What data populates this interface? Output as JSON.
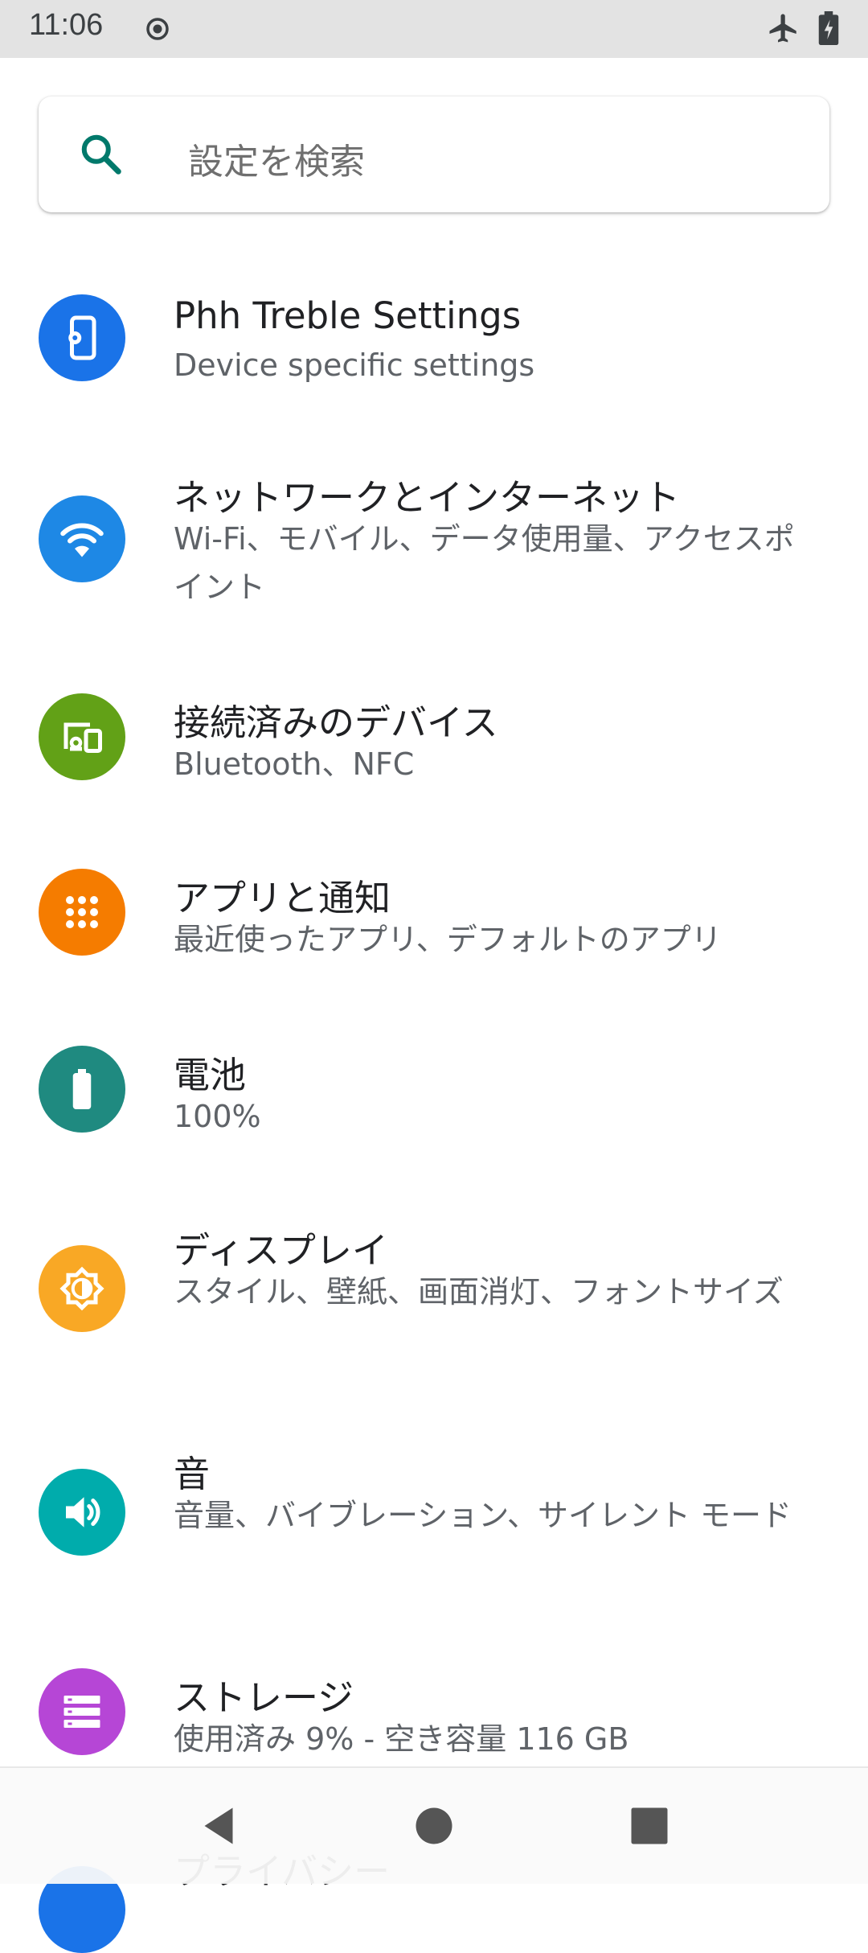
{
  "status_bar": {
    "time": "11:06"
  },
  "search": {
    "placeholder": "設定を検索"
  },
  "settings": [
    {
      "title": "Phh Treble Settings",
      "subtitle": "Device specific settings",
      "icon": "phone-gear-icon",
      "color": "#1a73e8"
    },
    {
      "title": "ネットワークとインターネット",
      "subtitle": "Wi-Fi、モバイル、データ使用量、アクセスポイント",
      "icon": "wifi-icon",
      "color": "#1e88e5"
    },
    {
      "title": "接続済みのデバイス",
      "subtitle": "Bluetooth、NFC",
      "icon": "devices-icon",
      "color": "#62a117"
    },
    {
      "title": "アプリと通知",
      "subtitle": "最近使ったアプリ、デフォルトのアプリ",
      "icon": "apps-grid-icon",
      "color": "#f57c00"
    },
    {
      "title": "電池",
      "subtitle": "100%",
      "icon": "battery-icon",
      "color": "#1f8a80"
    },
    {
      "title": "ディスプレイ",
      "subtitle": "スタイル、壁紙、画面消灯、フォントサイズ",
      "icon": "brightness-icon",
      "color": "#f9a825"
    },
    {
      "title": "音",
      "subtitle": "音量、バイブレーション、サイレント モード",
      "icon": "volume-icon",
      "color": "#00acac"
    },
    {
      "title": "ストレージ",
      "subtitle": "使用済み 9% - 空き容量 116 GB",
      "icon": "storage-icon",
      "color": "#b646d6"
    },
    {
      "title": "プライバシー",
      "subtitle": "",
      "icon": "privacy-icon",
      "color": "#1a73e8"
    }
  ],
  "nav": {
    "back": "back-icon",
    "home": "home-icon",
    "recents": "recents-icon"
  }
}
